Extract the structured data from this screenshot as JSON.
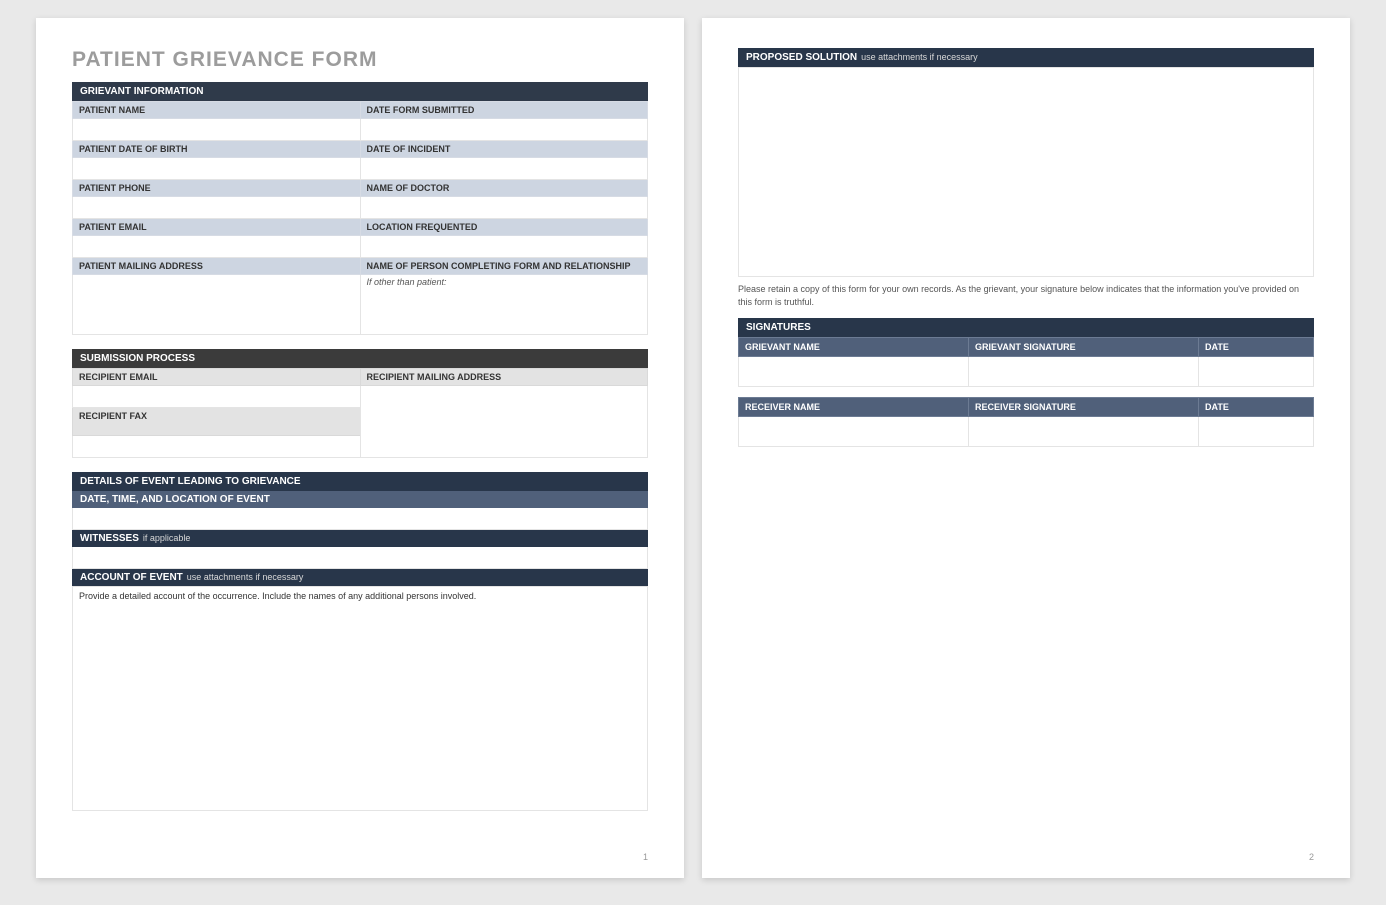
{
  "title": "PATIENT GRIEVANCE FORM",
  "page1_num": "1",
  "page2_num": "2",
  "grievant_info": {
    "header": "GRIEVANT INFORMATION",
    "labels": {
      "patient_name": "PATIENT NAME",
      "date_form_submitted": "DATE FORM SUBMITTED",
      "patient_dob": "PATIENT DATE OF BIRTH",
      "date_of_incident": "DATE OF INCIDENT",
      "patient_phone": "PATIENT PHONE",
      "name_of_doctor": "NAME OF DOCTOR",
      "patient_email": "PATIENT EMAIL",
      "location_frequented": "LOCATION FREQUENTED",
      "patient_mailing": "PATIENT MAILING ADDRESS",
      "completer": "NAME OF PERSON COMPLETING FORM AND RELATIONSHIP"
    },
    "completer_hint": "If other than patient:"
  },
  "submission": {
    "header": "SUBMISSION PROCESS",
    "labels": {
      "recipient_email": "RECIPIENT EMAIL",
      "recipient_mailing": "RECIPIENT MAILING ADDRESS",
      "recipient_fax": "RECIPIENT FAX"
    }
  },
  "details": {
    "header": "DETAILS OF EVENT LEADING TO GRIEVANCE",
    "date_time_loc": "DATE, TIME, AND LOCATION OF EVENT",
    "witnesses": "WITNESSES",
    "witnesses_note": "if applicable",
    "account": "ACCOUNT OF EVENT",
    "account_note": "use attachments if necessary",
    "account_hint": "Provide a detailed account of the occurrence.  Include the names of any additional persons involved."
  },
  "solution": {
    "header": "PROPOSED SOLUTION",
    "note": "use attachments if necessary"
  },
  "retain_note": "Please retain a copy of this form for your own records.  As the grievant, your signature below indicates that the information you've provided on this form is truthful.",
  "signatures": {
    "header": "SIGNATURES",
    "grievant_name": "GRIEVANT NAME",
    "grievant_sig": "GRIEVANT SIGNATURE",
    "date": "DATE",
    "receiver_name": "RECEIVER NAME",
    "receiver_sig": "RECEIVER SIGNATURE"
  }
}
